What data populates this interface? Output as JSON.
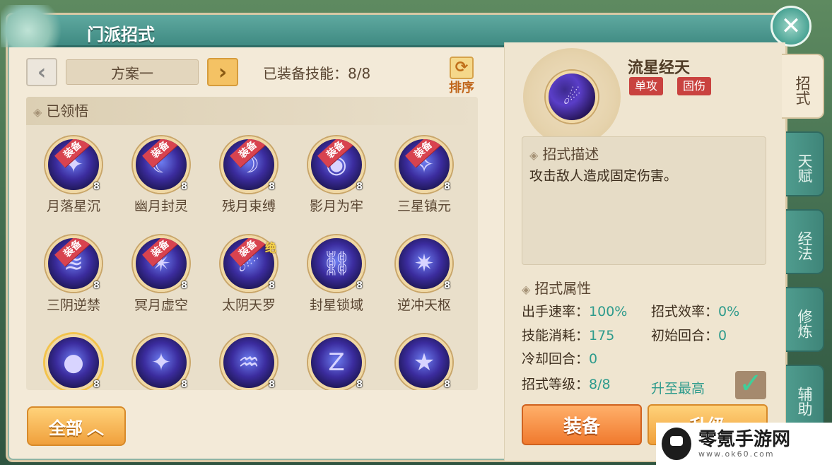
{
  "window": {
    "title": "门派招式",
    "close_icon": "✕"
  },
  "plan": {
    "prev_icon": "‹",
    "next_icon": "›",
    "name": "方案一",
    "equipped_label": "已装备技能：8/8",
    "sort_icon": "⟳",
    "sort_label": "排序"
  },
  "learned": {
    "header": "已领悟",
    "diamond": "◈",
    "skills": [
      {
        "name": "月落星沉",
        "level": "8",
        "equipped": "装备",
        "glyph": "✦"
      },
      {
        "name": "幽月封灵",
        "level": "8",
        "equipped": "装备",
        "glyph": "☾"
      },
      {
        "name": "残月束缚",
        "level": "8",
        "equipped": "装备",
        "glyph": "☽"
      },
      {
        "name": "影月为牢",
        "level": "8",
        "equipped": "装备",
        "glyph": "◉"
      },
      {
        "name": "三星镇元",
        "level": "8",
        "equipped": "装备",
        "glyph": "✧"
      },
      {
        "name": "三阴逆禁",
        "level": "8",
        "equipped": "装备",
        "glyph": "≋"
      },
      {
        "name": "冥月虚空",
        "level": "8",
        "equipped": "装备",
        "glyph": "✴"
      },
      {
        "name": "太阴天罗",
        "level": "8",
        "equipped": "装备",
        "glyph": "☄",
        "ult": "绝"
      },
      {
        "name": "封星锁域",
        "level": "8",
        "glyph": "⛓"
      },
      {
        "name": "逆冲天枢",
        "level": "8",
        "glyph": "✷"
      },
      {
        "level": "8",
        "glyph": "●"
      },
      {
        "level": "8",
        "glyph": "✦"
      },
      {
        "level": "8",
        "glyph": "♒"
      },
      {
        "level": "8",
        "glyph": "Z"
      },
      {
        "level": "8",
        "glyph": "★"
      }
    ]
  },
  "all_button": {
    "label": "全部",
    "chevron": "︿"
  },
  "detail": {
    "title": "流星经天",
    "tags": [
      "单攻",
      "固伤"
    ],
    "icon_glyph": "☄",
    "desc_header": "招式描述",
    "desc_text": "攻击敌人造成固定伤害。",
    "attr_header": "招式属性",
    "attrs": {
      "speed_label": "出手速率：",
      "speed_value": "100%",
      "efficiency_label": "招式效率：",
      "efficiency_value": "0%",
      "cost_label": "技能消耗：",
      "cost_value": "175",
      "initial_label": "初始回合：",
      "initial_value": "0",
      "cooldown_label": "冷却回合：",
      "cooldown_value": "0",
      "level_label": "招式等级：",
      "level_value": "8/8"
    },
    "max_label": "升至最高",
    "check_icon": "✓",
    "equip_button": "装备",
    "upgrade_button": "升级"
  },
  "side_tabs": [
    "招式",
    "天赋",
    "经法",
    "修炼",
    "辅助"
  ],
  "watermark": {
    "title": "零氪手游网",
    "url": "www.ok60.com"
  }
}
